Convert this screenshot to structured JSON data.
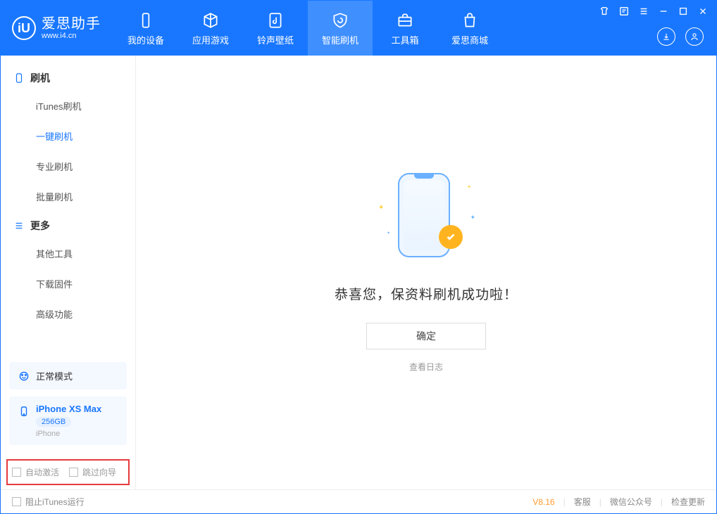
{
  "app": {
    "name_cn": "爱思助手",
    "url": "www.i4.cn"
  },
  "nav": [
    {
      "id": "my-device",
      "label": "我的设备"
    },
    {
      "id": "apps-games",
      "label": "应用游戏"
    },
    {
      "id": "ring-wall",
      "label": "铃声壁纸"
    },
    {
      "id": "smart-flash",
      "label": "智能刷机",
      "active": true
    },
    {
      "id": "toolbox",
      "label": "工具箱"
    },
    {
      "id": "store",
      "label": "爱思商城"
    }
  ],
  "sidebar": {
    "groups": [
      {
        "id": "flash",
        "title": "刷机",
        "items": [
          {
            "id": "itunes-flash",
            "label": "iTunes刷机"
          },
          {
            "id": "one-click",
            "label": "一键刷机",
            "active": true
          },
          {
            "id": "pro-flash",
            "label": "专业刷机"
          },
          {
            "id": "batch-flash",
            "label": "批量刷机"
          }
        ]
      },
      {
        "id": "more",
        "title": "更多",
        "items": [
          {
            "id": "other-tools",
            "label": "其他工具"
          },
          {
            "id": "download-fw",
            "label": "下载固件"
          },
          {
            "id": "advanced",
            "label": "高级功能"
          }
        ]
      }
    ]
  },
  "mode": {
    "label": "正常模式"
  },
  "device": {
    "name": "iPhone XS Max",
    "capacity": "256GB",
    "type": "iPhone"
  },
  "options": {
    "auto_activate": "自动激活",
    "skip_guide": "跳过向导"
  },
  "main": {
    "success_text": "恭喜您，保资料刷机成功啦！",
    "ok_label": "确定",
    "view_log": "查看日志"
  },
  "footer": {
    "block_itunes": "阻止iTunes运行",
    "version": "V8.16",
    "links": [
      "客服",
      "微信公众号",
      "检查更新"
    ]
  }
}
